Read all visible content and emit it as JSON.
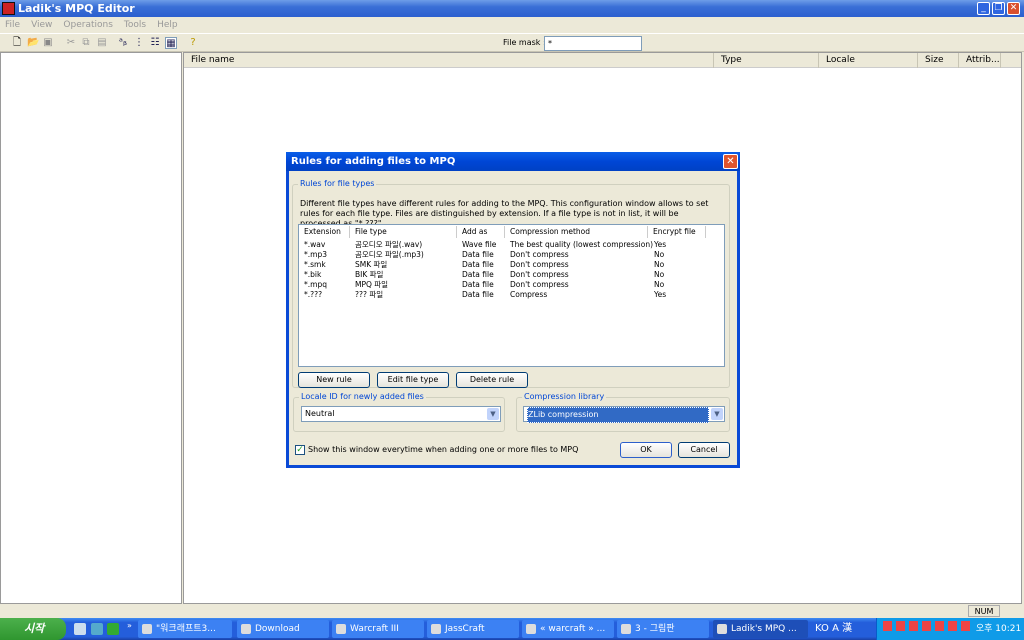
{
  "window": {
    "title": "Ladik's MPQ Editor"
  },
  "menu": [
    "File",
    "View",
    "Operations",
    "Tools",
    "Help"
  ],
  "toolbar": {
    "file_mask_label": "File mask :",
    "file_mask_value": "*"
  },
  "list_columns": [
    "File name",
    "Type",
    "Locale",
    "Size",
    "Attrib..."
  ],
  "status": {
    "num": "NUM"
  },
  "dialog": {
    "title": "Rules for adding files to MPQ",
    "rules_group": "Rules for file types",
    "description": "Different file types have different rules for adding to the MPQ. This configuration window allows to set rules for each file type. Files are distinguished by extension. If a file type is not in list, it will be processed as \"*.???\".",
    "columns": [
      "Extension",
      "File type",
      "Add as",
      "Compression method",
      "Encrypt file"
    ],
    "rows": [
      [
        "*.wav",
        "곰오디오 파일(.wav)",
        "Wave file",
        "The best quality (lowest compression)",
        "Yes"
      ],
      [
        "*.mp3",
        "곰오디오 파일(.mp3)",
        "Data file",
        "Don't compress",
        "No"
      ],
      [
        "*.smk",
        "SMK 파일",
        "Data file",
        "Don't compress",
        "No"
      ],
      [
        "*.bik",
        "BIK 파일",
        "Data file",
        "Don't compress",
        "No"
      ],
      [
        "*.mpq",
        "MPQ 파일",
        "Data file",
        "Don't compress",
        "No"
      ],
      [
        "*.???",
        "??? 파일",
        "Data file",
        "Compress",
        "Yes"
      ]
    ],
    "new_rule": "New rule",
    "edit_file_type": "Edit file type",
    "delete_rule": "Delete rule",
    "locale_group": "Locale ID for newly added files",
    "locale_value": "Neutral",
    "compression_group": "Compression library",
    "compression_value": "ZLib compression",
    "show_checkbox": "Show this window everytime when adding one or more files to MPQ",
    "show_checked": true,
    "ok": "OK",
    "cancel": "Cancel"
  },
  "taskbar": {
    "start": "시작",
    "chevron": "»",
    "tasks": [
      "\"워크래프트3...",
      "Download",
      "Warcraft III",
      "JassCraft",
      "« warcraft » ...",
      "3 - 그림판",
      "Ladik's MPQ ..."
    ],
    "lang": "KO",
    "lang_icons": "A 漢",
    "clock": "오후 10:21"
  }
}
